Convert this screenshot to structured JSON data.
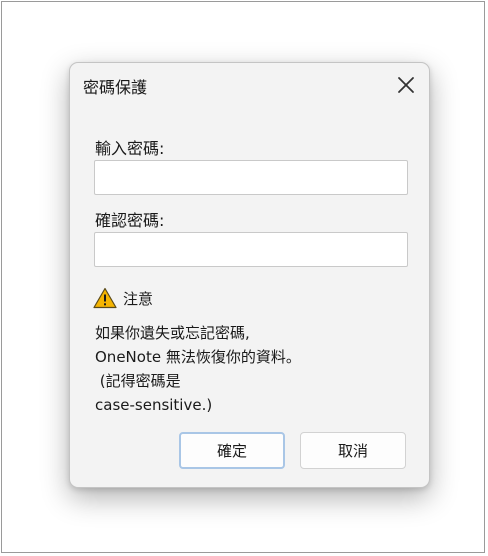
{
  "dialog": {
    "title": "密碼保護",
    "close_icon": "close-icon"
  },
  "form": {
    "enter_password_label": "輸入密碼:",
    "enter_password_value": "",
    "confirm_password_label": "確認密碼:",
    "confirm_password_value": ""
  },
  "warning": {
    "icon": "warning-icon",
    "heading": "注意",
    "lines": [
      "如果你遺失或忘記密碼,",
      "OneNote 無法恢復你的資料。",
      " (記得密碼是",
      "case-sensitive.)"
    ]
  },
  "buttons": {
    "ok_label": "確定",
    "cancel_label": "取消"
  },
  "colors": {
    "dialog_bg": "#f3f3f3",
    "warning_fill": "#f5b400",
    "default_button_border": "#a9c6e6"
  }
}
